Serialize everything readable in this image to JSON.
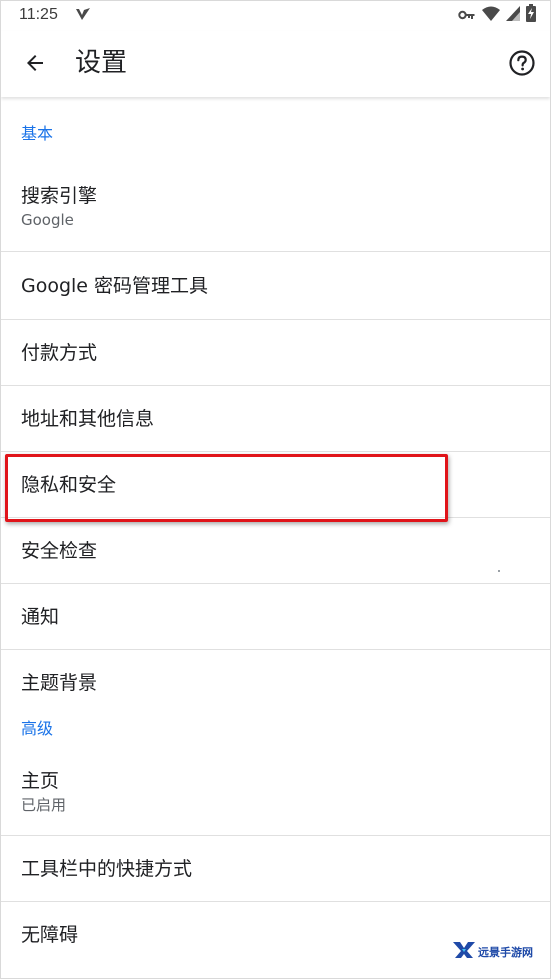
{
  "status_bar": {
    "time": "11:25"
  },
  "app_bar": {
    "title": "设置"
  },
  "sections": {
    "basic_header": "基本",
    "advanced_header": "高级"
  },
  "items": {
    "search_engine": {
      "title": "搜索引擎",
      "subtitle": "Google"
    },
    "password_manager": {
      "title": "Google 密码管理工具"
    },
    "payment_methods": {
      "title": "付款方式"
    },
    "addresses": {
      "title": "地址和其他信息"
    },
    "privacy_security": {
      "title": "隐私和安全"
    },
    "safety_check": {
      "title": "安全检查"
    },
    "notifications": {
      "title": "通知"
    },
    "theme": {
      "title": "主题背景"
    },
    "homepage": {
      "title": "主页",
      "subtitle": "已启用"
    },
    "toolbar_shortcut": {
      "title": "工具栏中的快捷方式"
    },
    "accessibility": {
      "title": "无障碍"
    }
  },
  "watermark": {
    "text": "远景手游网"
  },
  "colors": {
    "accent": "#1a73e8",
    "highlight": "#e0141a",
    "divider": "#e0e0e0"
  },
  "icons": {
    "back": "arrow-back-icon",
    "help": "help-circle-icon",
    "key": "vpn-key-icon",
    "wifi": "wifi-icon",
    "signal": "signal-icon",
    "battery": "battery-charging-icon"
  }
}
